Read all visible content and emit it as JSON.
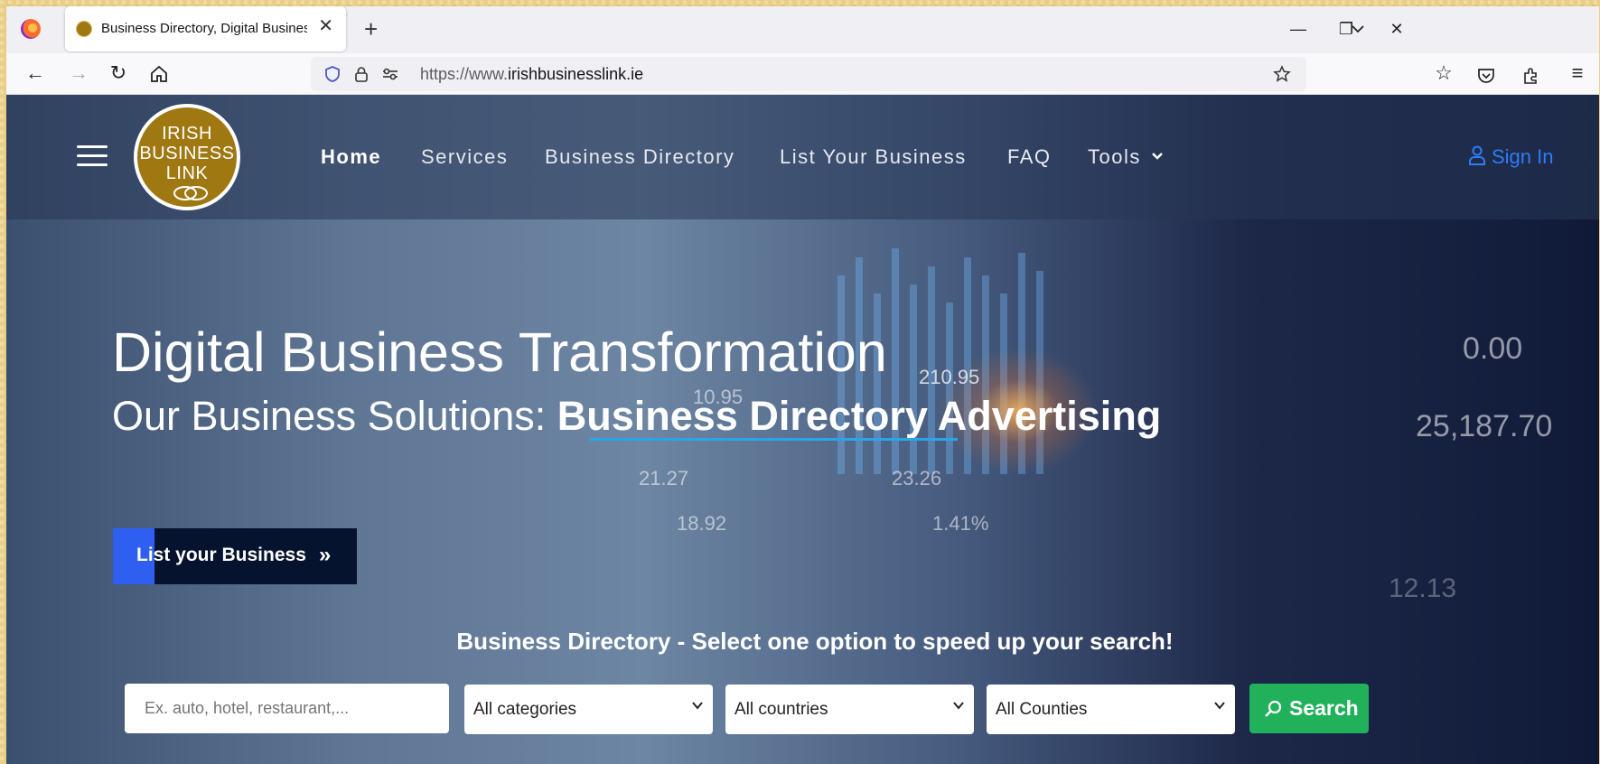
{
  "browser": {
    "tab_title": "Business Directory, Digital Business",
    "url_prefix": "https://www.",
    "url_domain": "irishbusinesslink.ie"
  },
  "site": {
    "logo_lines": [
      "IRISH",
      "BUSINESS",
      "LINK"
    ],
    "nav": [
      "Home",
      "Services",
      "Business Directory",
      "List Your Business",
      "FAQ",
      "Tools"
    ],
    "sign_in": "Sign In"
  },
  "hero": {
    "title": "Digital Business Transformation",
    "subtitle_prefix": "Our Business Solutions:",
    "subtitle_highlight": "Business Directory Advertising",
    "cta_label": "List your Business"
  },
  "background_numbers": [
    "210.95",
    "10.95",
    "23.26",
    "1.41%",
    "18.92",
    "21.27",
    "0.00",
    "25,187.70",
    "12.13"
  ],
  "search": {
    "heading": "Business Directory - Select one option to speed up your search!",
    "placeholder": "Ex. auto, hotel, restaurant,...",
    "category": "All categories",
    "country": "All countries",
    "county": "All Counties",
    "button": "Search"
  },
  "colors": {
    "brand_gold": "#a07811",
    "accent_blue": "#2f7cf6",
    "search_green": "#22b15b",
    "underline_blue": "#2aa6e8"
  }
}
